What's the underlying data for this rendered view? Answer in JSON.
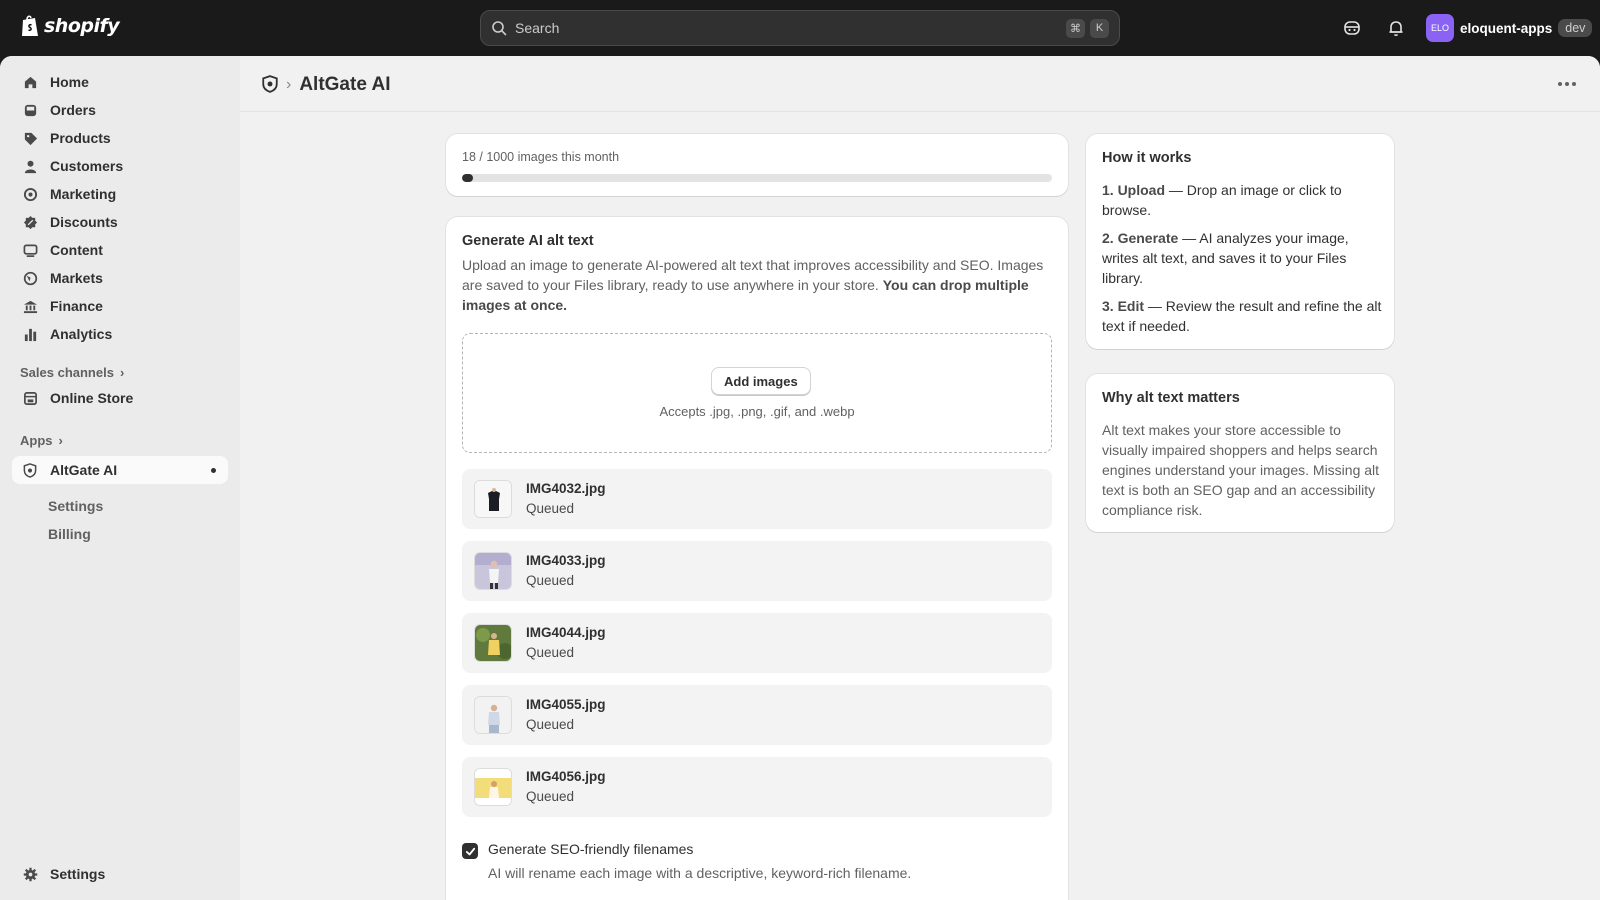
{
  "topbar": {
    "brand": "shopify",
    "search_placeholder": "Search",
    "shortcut_keys": [
      "⌘",
      "K"
    ],
    "account_initials": "ELO",
    "account_name": "eloquent-apps",
    "env_badge": "dev"
  },
  "sidebar": {
    "items": [
      {
        "label": "Home",
        "icon": "home-icon"
      },
      {
        "label": "Orders",
        "icon": "inbox-icon"
      },
      {
        "label": "Products",
        "icon": "tag-icon"
      },
      {
        "label": "Customers",
        "icon": "person-icon"
      },
      {
        "label": "Marketing",
        "icon": "target-icon"
      },
      {
        "label": "Discounts",
        "icon": "discount-icon"
      },
      {
        "label": "Content",
        "icon": "image-icon"
      },
      {
        "label": "Markets",
        "icon": "globe-icon"
      },
      {
        "label": "Finance",
        "icon": "bank-icon"
      },
      {
        "label": "Analytics",
        "icon": "bar-chart-icon"
      }
    ],
    "sales_channels_label": "Sales channels",
    "online_store_label": "Online Store",
    "apps_label": "Apps",
    "app_name": "AltGate AI",
    "app_sub_items": [
      "Settings",
      "Billing"
    ],
    "settings_label": "Settings"
  },
  "page": {
    "title": "AltGate AI"
  },
  "usage": {
    "text": "18 / 1000 images this month",
    "used": 18,
    "limit": 1000
  },
  "generate": {
    "title": "Generate AI alt text",
    "description": "Upload an image to generate AI-powered alt text that improves accessibility and SEO. Images are saved to your Files library, ready to use anywhere in your store.",
    "description_bold": "You can drop multiple images at once.",
    "add_button": "Add images",
    "accepts": "Accepts .jpg, .png, .gif, and .webp",
    "files": [
      {
        "name": "IMG4032.jpg",
        "status": "Queued"
      },
      {
        "name": "IMG4033.jpg",
        "status": "Queued"
      },
      {
        "name": "IMG4044.jpg",
        "status": "Queued"
      },
      {
        "name": "IMG4055.jpg",
        "status": "Queued"
      },
      {
        "name": "IMG4056.jpg",
        "status": "Queued"
      }
    ],
    "seo_checkbox_label": "Generate SEO-friendly filenames",
    "seo_checkbox_help": "AI will rename each image with a descriptive, keyword-rich filename.",
    "seo_checked": true
  },
  "how_it_works": {
    "title": "How it works",
    "steps": [
      {
        "bold": "1. Upload",
        "text": " — Drop an image or click to browse."
      },
      {
        "bold": "2. Generate",
        "text": " — AI analyzes your image, writes alt text, and saves it to your Files library."
      },
      {
        "bold": "3. Edit",
        "text": " — Review the result and refine the alt text if needed."
      }
    ]
  },
  "why": {
    "title": "Why alt text matters",
    "body": "Alt text makes your store accessible to visually impaired shoppers and helps search engines understand your images. Missing alt text is both an SEO gap and an accessibility compliance risk."
  }
}
